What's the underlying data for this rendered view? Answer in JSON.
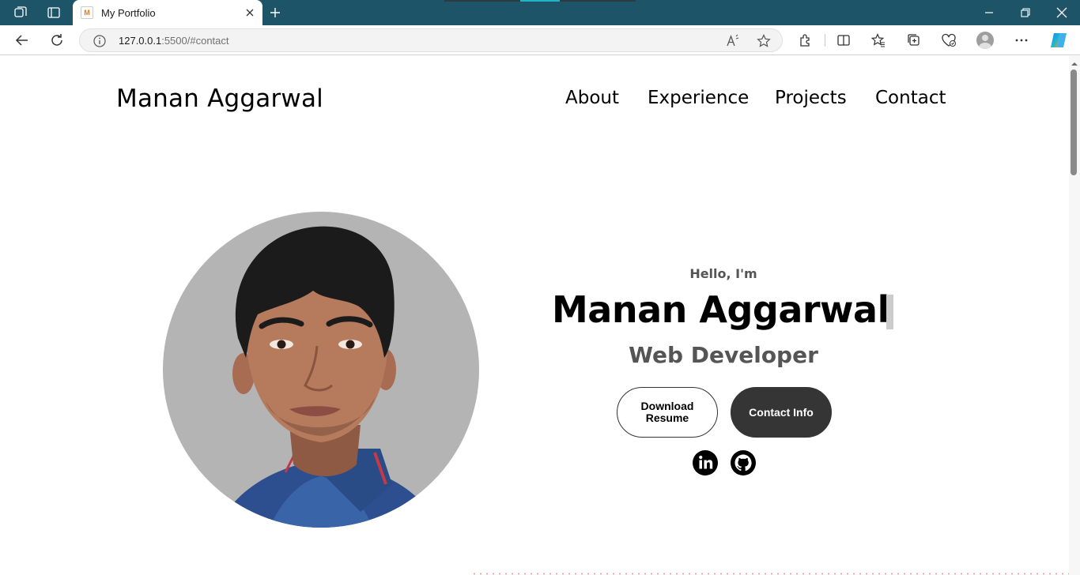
{
  "browser": {
    "tab_title": "My Portfolio",
    "tab_favicon_letter": "M",
    "url_host": "127.0.0.1",
    "url_rest": ":5500/#contact",
    "icons": {
      "workspaces": "workspaces-icon",
      "tab_actions": "tab-actions-icon",
      "close_tab": "close-icon",
      "new_tab": "plus-icon",
      "minimize": "minimize-icon",
      "restore": "restore-icon",
      "close_window": "close-icon",
      "back": "back-arrow-icon",
      "refresh": "refresh-icon",
      "site_info": "info-icon",
      "read_aloud": "read-aloud-icon",
      "favorite": "star-icon",
      "extensions": "puzzle-icon",
      "split_screen": "split-screen-icon",
      "favorites": "favorites-icon",
      "collections": "collections-icon",
      "browser_essentials": "heart-pulse-icon",
      "profile": "profile-avatar",
      "more": "more-dots-icon",
      "copilot": "copilot-icon"
    },
    "accent_color": "#1e5468"
  },
  "site": {
    "logo": "Manan Aggarwal",
    "nav": [
      "About",
      "Experience",
      "Projects",
      "Contact"
    ]
  },
  "hero": {
    "greeting": "Hello, I'm",
    "name": "Manan Aggarwal",
    "role": "Web Developer",
    "buttons": {
      "download_line1": "Download",
      "download_line2": "Resume",
      "contact": "Contact Info"
    },
    "social_icons": [
      "linkedin-icon",
      "github-icon"
    ],
    "profile_image": "profile-photo"
  },
  "colors": {
    "dark_button": "#353535",
    "muted_text": "#555555",
    "photo_bg": "#b4b4b4",
    "dotted_divider": "#f2a3a3"
  }
}
